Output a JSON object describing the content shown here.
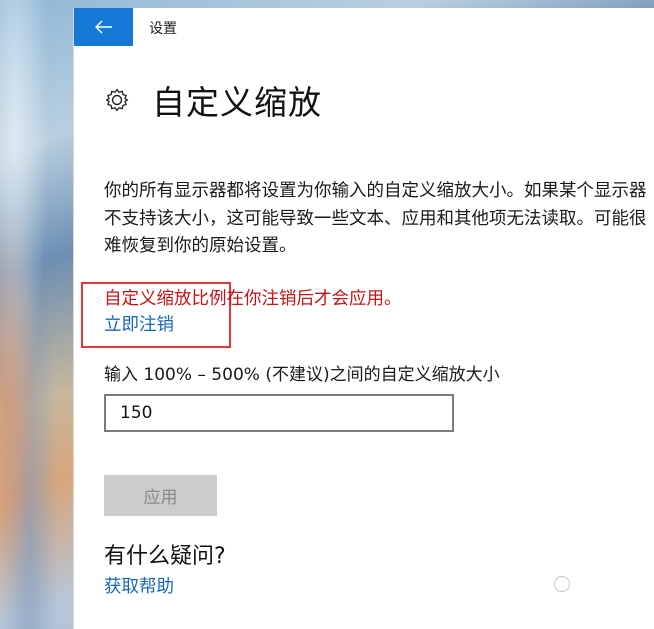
{
  "window": {
    "title": "设置"
  },
  "page": {
    "title": "自定义缩放",
    "description": "你的所有显示器都将设置为你输入的自定义缩放大小。如果某个显示器不支持该大小，这可能导致一些文本、应用和其他项无法读取。可能很难恢复到你的原始设置。",
    "notice": "自定义缩放比例在你注销后才会应用。",
    "signout_link": "立即注销",
    "input_label": "输入 100% – 500% (不建议)之间的自定义缩放大小",
    "input_value": "150",
    "apply_label": "应用",
    "help_heading": "有什么疑问?",
    "help_link": "获取帮助"
  },
  "icons": {
    "back": "arrow-left-icon",
    "header": "gear-icon"
  },
  "colors": {
    "accent": "#1479d7",
    "link": "#1767b8",
    "notice": "#c41616",
    "highlight_box": "#e03a3a",
    "disabled_button": "#cccccc"
  }
}
